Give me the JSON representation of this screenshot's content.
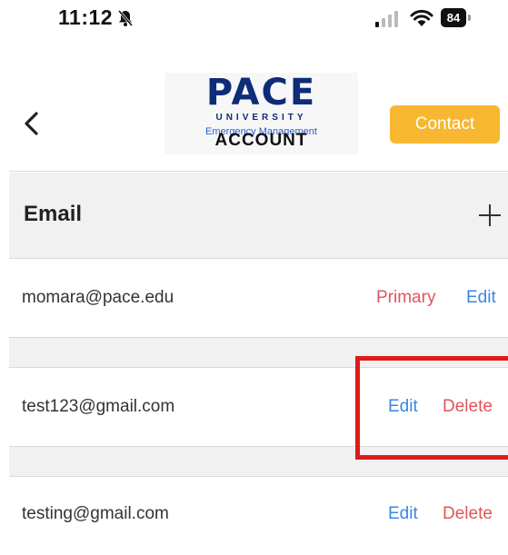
{
  "status_bar": {
    "time": "11:12",
    "battery_level": "84",
    "icons": [
      "bell-slash-icon",
      "signal-icon",
      "wifi-icon",
      "battery-icon"
    ]
  },
  "header": {
    "logo": {
      "name": "PACE",
      "sub": "UNIVERSITY",
      "tagline": "Emergency Management"
    },
    "title": "ACCOUNT",
    "contact_label": "Contact",
    "back_icon": "chevron-left-icon"
  },
  "email_section": {
    "title": "Email",
    "add_icon": "plus-icon",
    "rows": [
      {
        "address": "momara@pace.edu",
        "actions": [
          "Primary",
          "Edit"
        ]
      },
      {
        "address": "test123@gmail.com",
        "actions": [
          "Edit",
          "Delete"
        ]
      },
      {
        "address": "testing@gmail.com",
        "actions": [
          "Edit",
          "Delete"
        ]
      }
    ]
  },
  "colors": {
    "accent_contact": "#f8b731",
    "link_blue": "#3a86e4",
    "link_red": "#e0555a",
    "highlight": "#e01a1a",
    "brand_navy": "#0e2c78"
  }
}
